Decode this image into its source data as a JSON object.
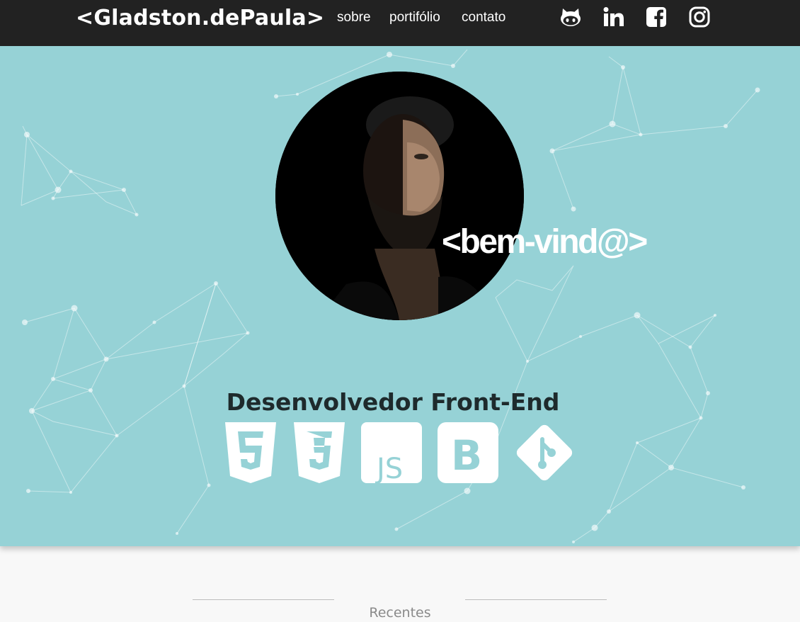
{
  "navbar": {
    "brand": "<Gladston.dePaula>",
    "links": [
      "sobre",
      "portifólio",
      "contato"
    ],
    "social_icons": [
      "github-icon",
      "linkedin-icon",
      "facebook-icon",
      "instagram-icon"
    ]
  },
  "hero": {
    "welcome": "<bem-vind@>",
    "role": "Desenvolvedor Front-End",
    "tech_icons": [
      "html5-icon",
      "css3-icon",
      "javascript-icon",
      "bootstrap-icon",
      "git-icon"
    ],
    "colors": {
      "background": "#96d2d6",
      "navbar": "#222222",
      "icon": "#ffffff"
    }
  },
  "recent": {
    "title": "Recentes"
  }
}
